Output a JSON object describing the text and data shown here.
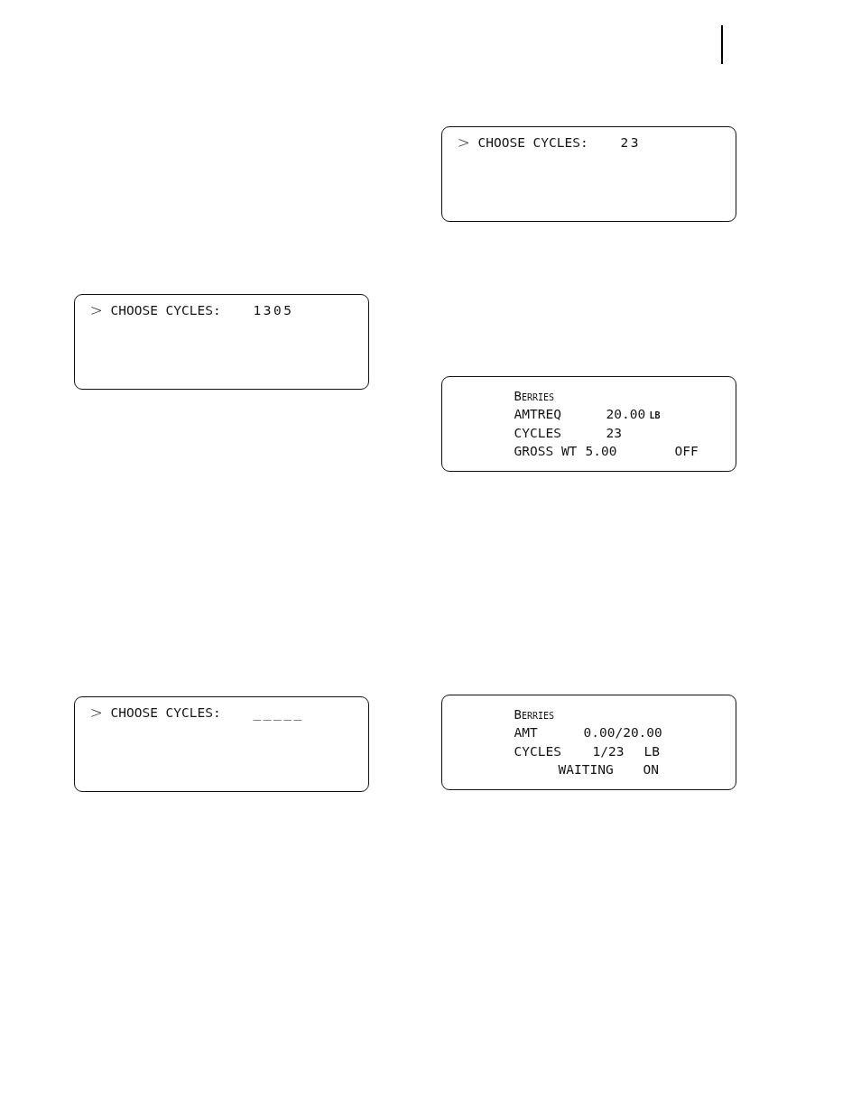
{
  "left_column": {
    "displays": [
      {
        "kind": "prompt",
        "cursor": ">",
        "label": "CHOOSE CYCLES:",
        "value": "1305"
      },
      {
        "kind": "prompt",
        "cursor": ">",
        "label": "CHOOSE CYCLES:",
        "value": "_____"
      }
    ]
  },
  "right_column": {
    "displays": [
      {
        "kind": "prompt",
        "cursor": ">",
        "label": "CHOOSE CYCLES:",
        "value": "23"
      },
      {
        "kind": "status",
        "lines": [
          {
            "cells": [
              {
                "kind": "heading",
                "text": "Berries"
              }
            ]
          },
          {
            "cells": [
              {
                "kind": "text",
                "text": "AMTREQ"
              },
              {
                "kind": "text",
                "text": "20.00"
              },
              {
                "kind": "small",
                "text": "LB"
              }
            ]
          },
          {
            "cells": [
              {
                "kind": "text",
                "text": "CYCLES"
              },
              {
                "kind": "text",
                "text": "23"
              }
            ]
          },
          {
            "cells": [
              {
                "kind": "text",
                "text": "GROSS WT"
              },
              {
                "kind": "text",
                "text": "5.00"
              },
              {
                "kind": "text",
                "text": "OFF"
              }
            ]
          }
        ]
      },
      {
        "kind": "status",
        "lines": [
          {
            "cells": [
              {
                "kind": "heading",
                "text": "Berries"
              }
            ]
          },
          {
            "cells": [
              {
                "kind": "text",
                "text": "AMT"
              },
              {
                "kind": "text",
                "text": "0.00/20.00"
              }
            ]
          },
          {
            "cells": [
              {
                "kind": "text",
                "text": "CYCLES"
              },
              {
                "kind": "text",
                "text": "1/23"
              },
              {
                "kind": "text",
                "text": "LB"
              }
            ]
          },
          {
            "cells": [
              {
                "kind": "text",
                "text": "WAITING"
              },
              {
                "kind": "text",
                "text": "ON"
              }
            ]
          }
        ]
      }
    ]
  }
}
